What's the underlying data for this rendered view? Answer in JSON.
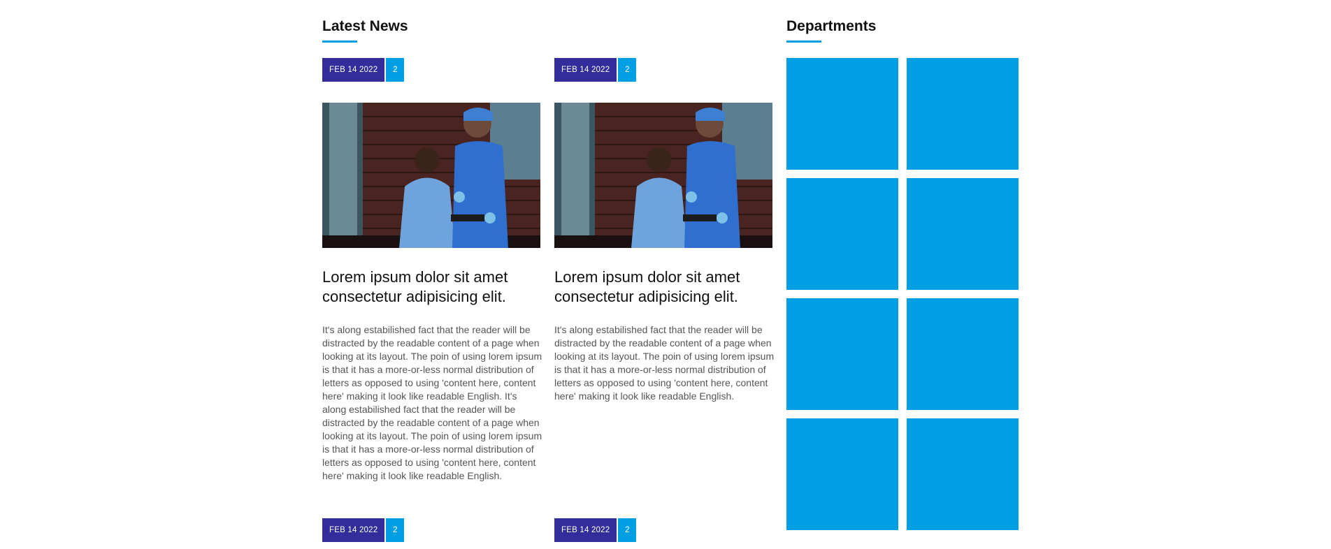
{
  "latest_news": {
    "title": "Latest News",
    "articles": [
      {
        "date": "FEB 14 2022",
        "count": "2",
        "title": "Lorem ipsum dolor sit amet consectetur adipisicing elit.",
        "body": "It's along estabilished fact that the reader will be distracted by the readable content of a page when looking at its layout. The poin of using lorem ipsum is that it has a more-or-less normal distribution of letters as opposed to using 'content here, content here' making it look like readable English. It's along estabilished fact that the reader will be distracted by the readable content of a page when looking at its layout. The poin of using lorem ipsum is that it has a more-or-less normal distribution of letters as opposed to using 'content here, content here' making it look like readable English."
      },
      {
        "date": "FEB 14 2022",
        "count": "2",
        "title": "Lorem ipsum dolor sit amet consectetur adipisicing elit.",
        "body": "It's along estabilished fact that the reader will be distracted by the readable content of a page when looking at its layout. The poin of using lorem ipsum is that it has a more-or-less normal distribution of letters as opposed to using 'content here, content here' making it look like readable English."
      }
    ],
    "footer_meta": [
      {
        "date": "FEB 14 2022",
        "count": "2"
      },
      {
        "date": "FEB 14 2022",
        "count": "2"
      }
    ]
  },
  "departments": {
    "title": "Departments",
    "tile_count": 8
  },
  "colors": {
    "accent": "#009fe3",
    "date_badge": "#322d9b",
    "body_text": "#555555"
  }
}
